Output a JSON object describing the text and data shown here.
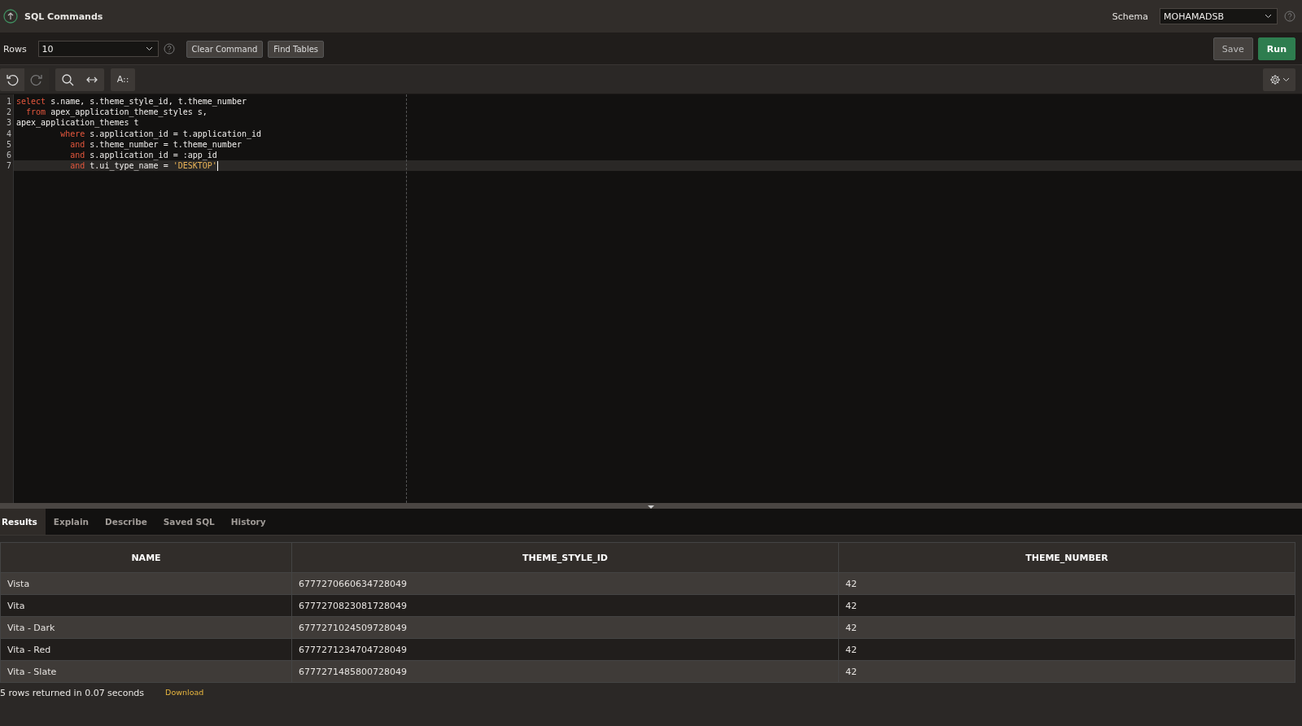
{
  "header": {
    "title": "SQL Commands",
    "schema_label": "Schema",
    "schema_value": "MOHAMADSB"
  },
  "toolbar": {
    "rows_label": "Rows",
    "rows_value": "10",
    "buttons": [
      "Clear Command",
      "Find Tables"
    ],
    "save": "Save",
    "run": "Run"
  },
  "editor_toolbar": {
    "font_button": "A::"
  },
  "editor": {
    "lines": [
      {
        "number": "1",
        "current": false,
        "tokens": [
          {
            "kind": "keyword",
            "text": "select"
          },
          {
            "kind": "plain",
            "text": " s.name, s.theme_style_id, t.theme_number"
          }
        ]
      },
      {
        "number": "2",
        "current": false,
        "tokens": [
          {
            "kind": "keyword",
            "text": "  from"
          },
          {
            "kind": "plain",
            "text": " apex_application_theme_styles s,"
          }
        ]
      },
      {
        "number": "3",
        "current": false,
        "tokens": [
          {
            "kind": "plain",
            "text": "apex_application_themes t"
          }
        ]
      },
      {
        "number": "4",
        "current": false,
        "tokens": [
          {
            "kind": "keyword",
            "text": "         where"
          },
          {
            "kind": "plain",
            "text": " s.application_id = t.application_id"
          }
        ]
      },
      {
        "number": "5",
        "current": false,
        "tokens": [
          {
            "kind": "keyword",
            "text": "           and"
          },
          {
            "kind": "plain",
            "text": " s.theme_number = t.theme_number"
          }
        ]
      },
      {
        "number": "6",
        "current": false,
        "tokens": [
          {
            "kind": "keyword",
            "text": "           and"
          },
          {
            "kind": "plain",
            "text": " s.application_id = :app_id"
          }
        ]
      },
      {
        "number": "7",
        "current": true,
        "tokens": [
          {
            "kind": "keyword",
            "text": "           and"
          },
          {
            "kind": "plain",
            "text": " t.ui_type_name = "
          },
          {
            "kind": "string",
            "text": "'DESKTOP'"
          }
        ]
      }
    ]
  },
  "tabs": [
    {
      "label": "Results",
      "selected": true
    },
    {
      "label": "Explain",
      "selected": false
    },
    {
      "label": "Describe",
      "selected": false
    },
    {
      "label": "Saved SQL",
      "selected": false
    },
    {
      "label": "History",
      "selected": false
    }
  ],
  "table": {
    "columns": [
      "NAME",
      "THEME_STYLE_ID",
      "THEME_NUMBER"
    ],
    "rows": [
      [
        "Vista",
        "6777270660634728049",
        "42"
      ],
      [
        "Vita",
        "6777270823081728049",
        "42"
      ],
      [
        "Vita - Dark",
        "6777271024509728049",
        "42"
      ],
      [
        "Vita - Red",
        "6777271234704728049",
        "42"
      ],
      [
        "Vita - Slate",
        "6777271485800728049",
        "42"
      ]
    ]
  },
  "status": {
    "message": "5 rows returned in 0.07 seconds",
    "download": "Download"
  }
}
